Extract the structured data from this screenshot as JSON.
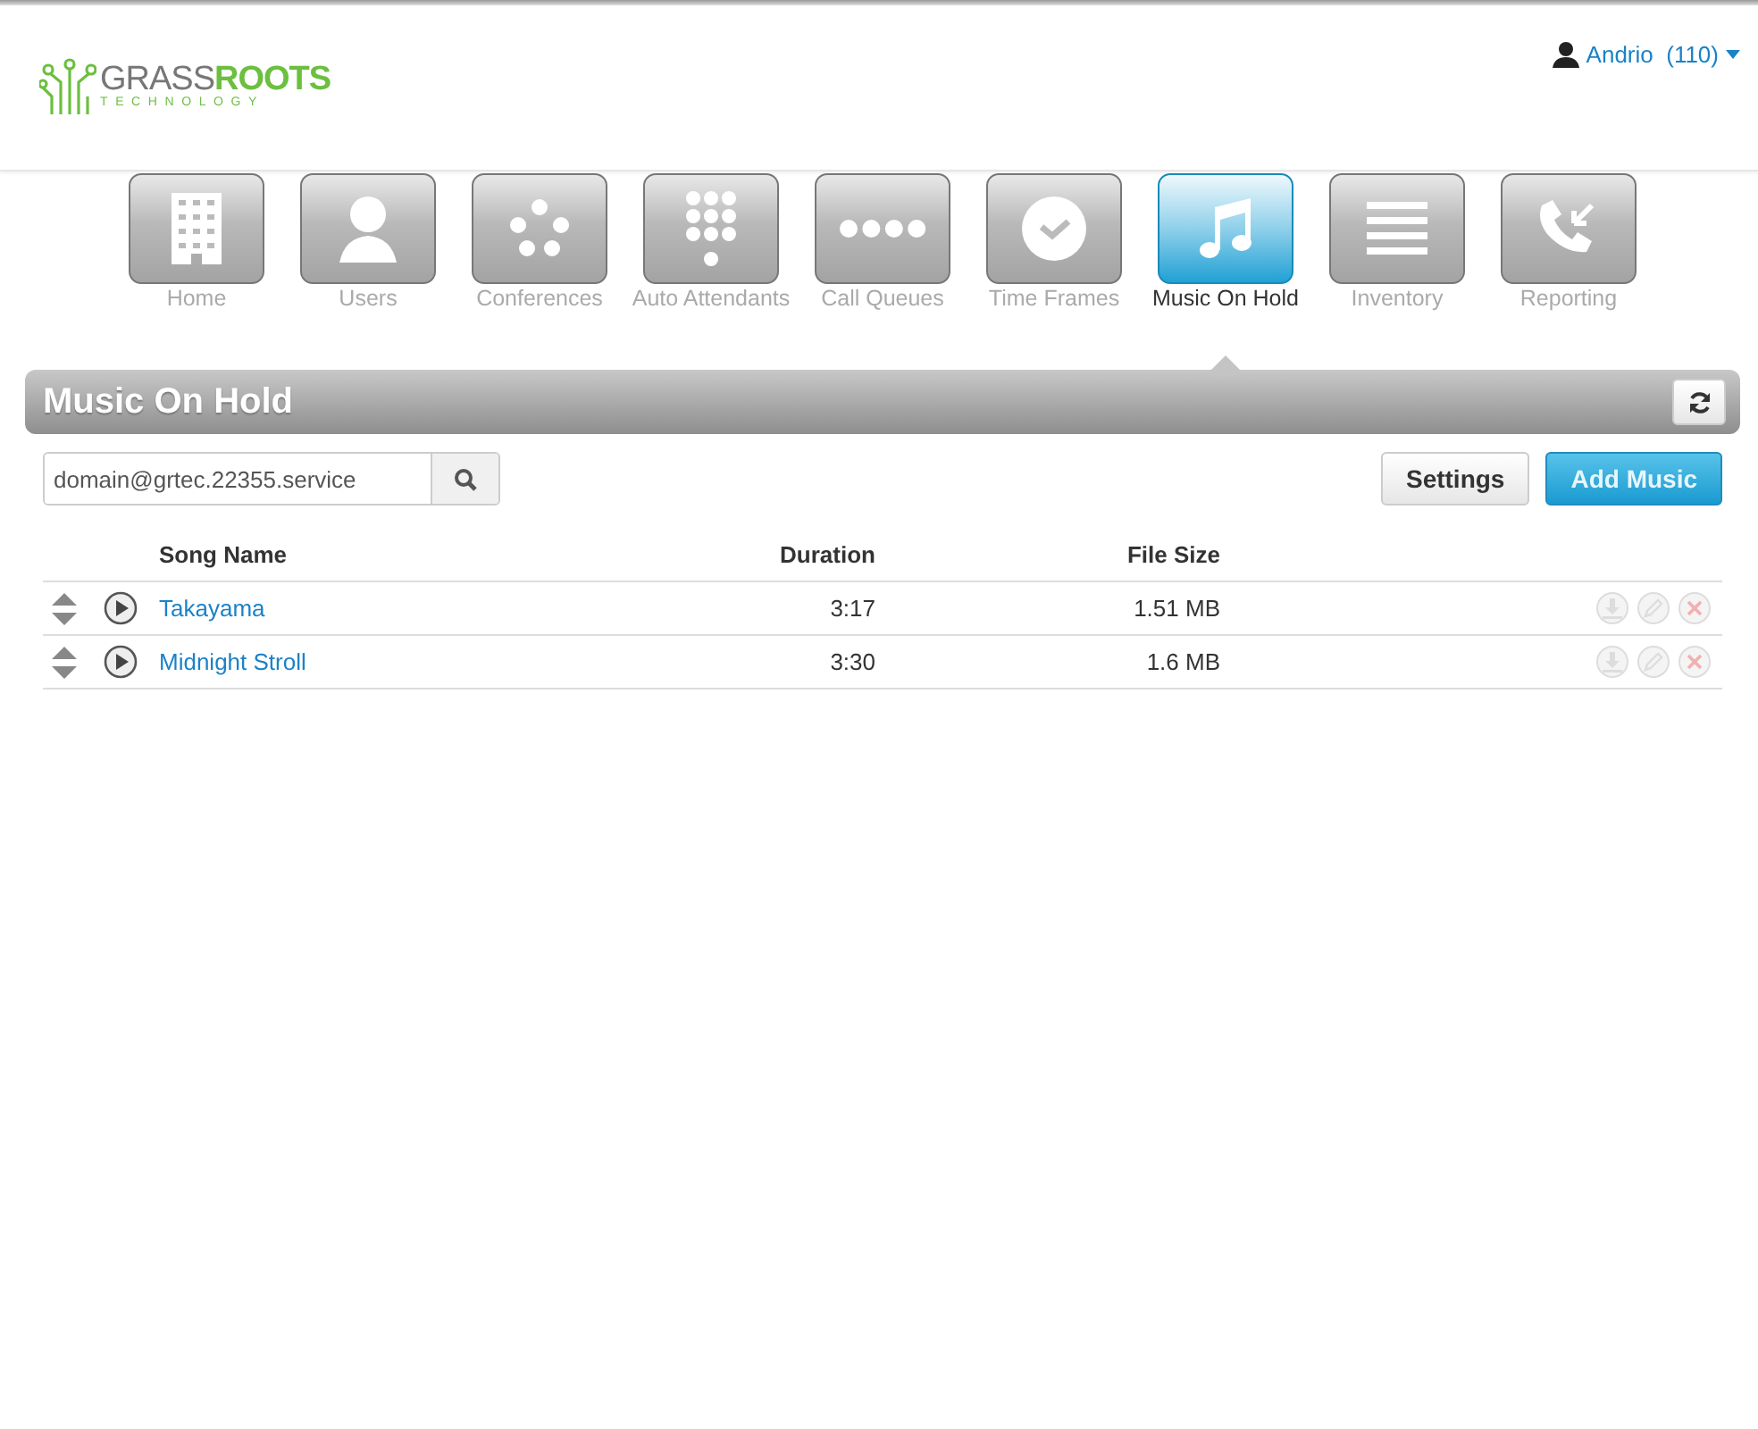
{
  "logo": {
    "part1": "GRASS",
    "part2": "ROOTS",
    "tagline": "TECHNOLOGY"
  },
  "user": {
    "name": "Andrio",
    "extension": "(110)"
  },
  "nav": [
    {
      "label": "Home",
      "kind": "building",
      "selected": false
    },
    {
      "label": "Users",
      "kind": "person",
      "selected": false
    },
    {
      "label": "Conferences",
      "kind": "circle-dots",
      "selected": false
    },
    {
      "label": "Auto Attendants",
      "kind": "keypad",
      "selected": false
    },
    {
      "label": "Call Queues",
      "kind": "row-dots",
      "selected": false
    },
    {
      "label": "Time Frames",
      "kind": "clock",
      "selected": false
    },
    {
      "label": "Music On Hold",
      "kind": "note",
      "selected": true
    },
    {
      "label": "Inventory",
      "kind": "lines",
      "selected": false
    },
    {
      "label": "Reporting",
      "kind": "phone",
      "selected": false
    }
  ],
  "panel": {
    "title": "Music On Hold"
  },
  "search": {
    "value": "domain@grtec.22355.service"
  },
  "buttons": [
    {
      "label": "Settings",
      "kind": "default"
    },
    {
      "label": "Add Music",
      "kind": "primary"
    }
  ],
  "table": {
    "columns": [
      "Song Name",
      "Duration",
      "File Size"
    ],
    "rows": [
      {
        "song": "Takayama",
        "duration": "3:17",
        "size": "1.51 MB"
      },
      {
        "song": "Midnight Stroll",
        "duration": "3:30",
        "size": "1.6 MB"
      }
    ]
  }
}
